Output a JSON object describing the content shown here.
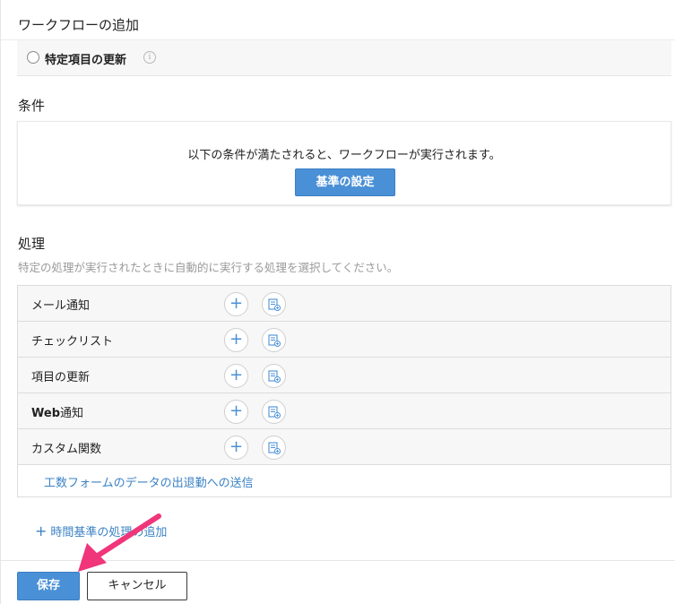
{
  "page": {
    "title": "ワークフローの追加"
  },
  "trigger": {
    "option_label": "特定項目の更新",
    "info_glyph": "i"
  },
  "conditions": {
    "heading": "条件",
    "message": "以下の条件が満たされると、ワークフローが実行されます。",
    "button_label": "基準の設定"
  },
  "actions": {
    "heading": "処理",
    "description": "特定の処理が実行されたときに自動的に実行する処理を選択してください。",
    "rows": [
      {
        "label": "メール通知"
      },
      {
        "label": "チェックリスト"
      },
      {
        "label": "項目の更新"
      },
      {
        "label_bold": "Web",
        "label_rest": "通知"
      },
      {
        "label": "カスタム関数"
      }
    ],
    "add_glyph": "+",
    "link_label": "工数フォームのデータの出退勤への送信"
  },
  "time_based": {
    "glyph": "+",
    "label": "時間基準の処理の追加"
  },
  "footer": {
    "save_label": "保存",
    "cancel_label": "キャンセル"
  },
  "colors": {
    "accent": "#4a90d6",
    "link": "#3b82c4",
    "annotation_arrow": "#f0357a"
  }
}
